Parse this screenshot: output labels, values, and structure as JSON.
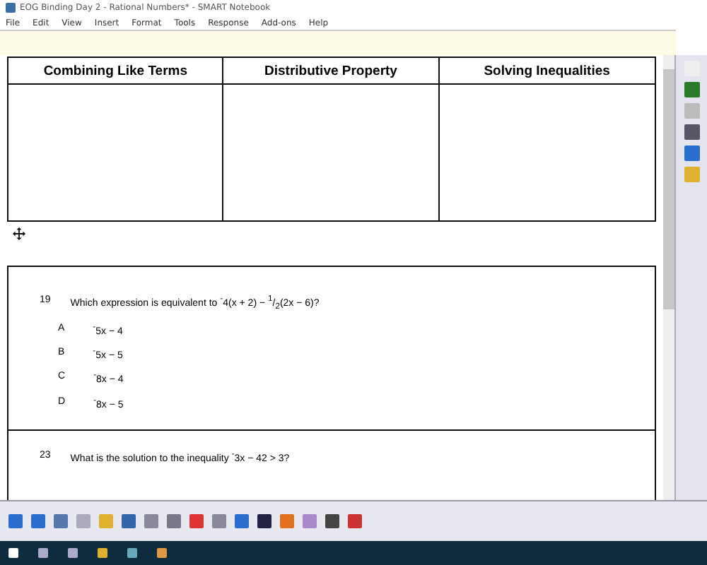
{
  "window": {
    "title": "EOG Binding Day 2 - Rational Numbers* - SMART Notebook"
  },
  "menu": [
    "File",
    "Edit",
    "View",
    "Insert",
    "Format",
    "Tools",
    "Response",
    "Add-ons",
    "Help"
  ],
  "table": {
    "columns": [
      "Combining Like Terms",
      "Distributive Property",
      "Solving Inequalities"
    ]
  },
  "questions": [
    {
      "number": "19",
      "text": "Which expression is equivalent to $^{-}$4(x + 2) − $^{1}$/$_{2}$(2x − 6)?",
      "answers": [
        {
          "letter": "A",
          "text": "$^{-}$5x − 4"
        },
        {
          "letter": "B",
          "text": "$^{-}$5x − 5"
        },
        {
          "letter": "C",
          "text": "$^{-}$8x − 4"
        },
        {
          "letter": "D",
          "text": "$^{-}$8x − 5"
        }
      ]
    },
    {
      "number": "23",
      "text": "What is the solution to the inequality $^{-}$3x − 42 > 3?"
    }
  ]
}
